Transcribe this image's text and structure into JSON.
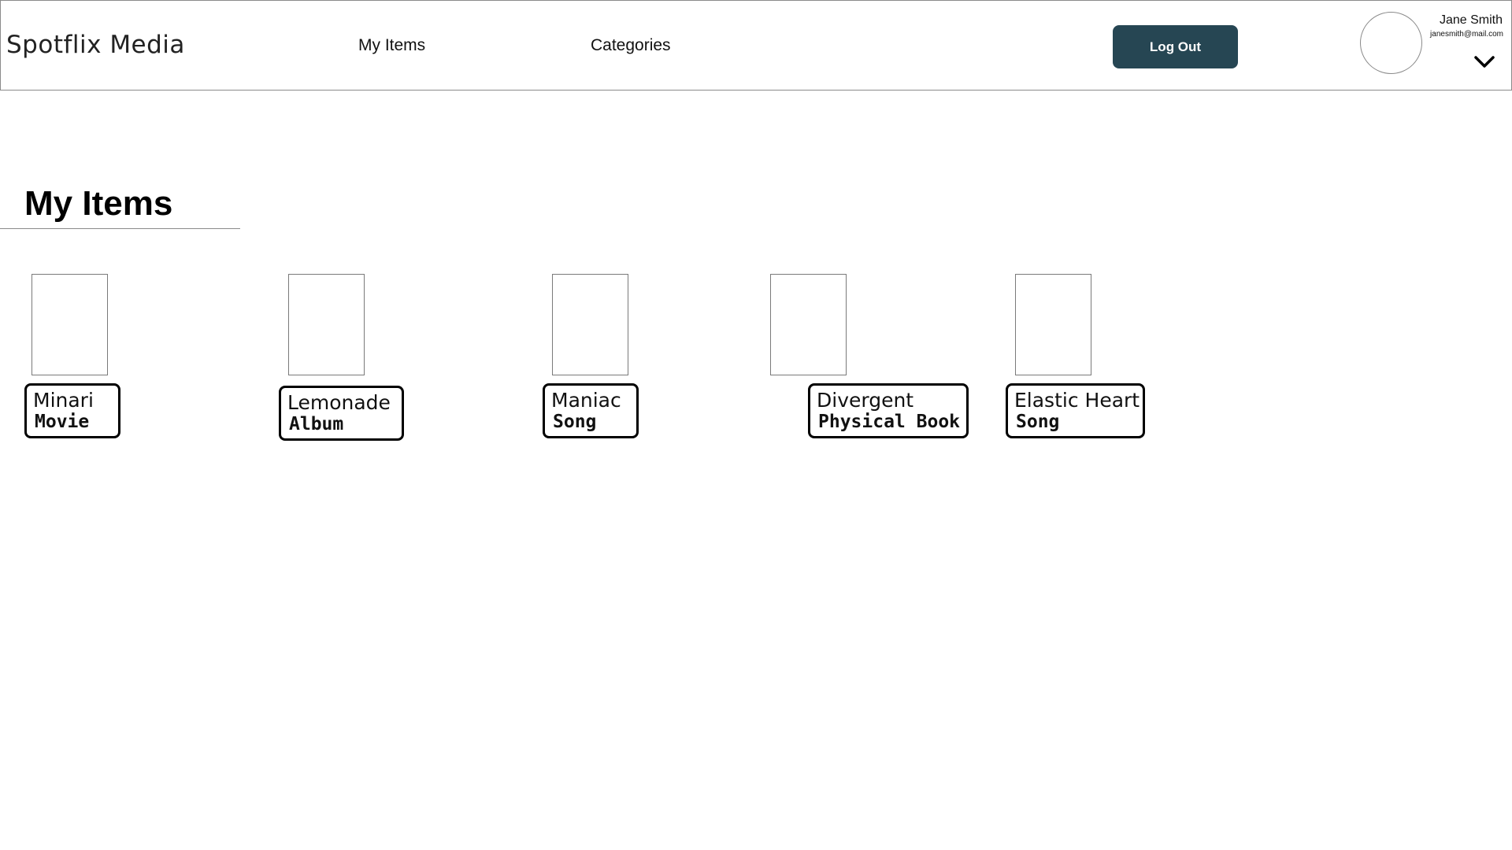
{
  "header": {
    "brand": "Spotflix Media",
    "nav": [
      {
        "label": "My Items"
      },
      {
        "label": "Categories"
      }
    ],
    "logout_label": "Log Out",
    "user": {
      "name": "Jane Smith",
      "email": "janesmith@mail.com"
    },
    "icons": {
      "avatar": "avatar-placeholder",
      "dropdown": "chevron-down-icon"
    }
  },
  "main": {
    "title": "My Items",
    "items": [
      {
        "title": "Minari",
        "type": "Movie"
      },
      {
        "title": "Lemonade",
        "type": "Album"
      },
      {
        "title": "Maniac",
        "type": "Song"
      },
      {
        "title": "Divergent",
        "type": "Physical Book"
      },
      {
        "title": "Elastic Heart",
        "type": "Song"
      }
    ]
  },
  "colors": {
    "logout_button": "#264653",
    "border": "#8a8a8a"
  }
}
